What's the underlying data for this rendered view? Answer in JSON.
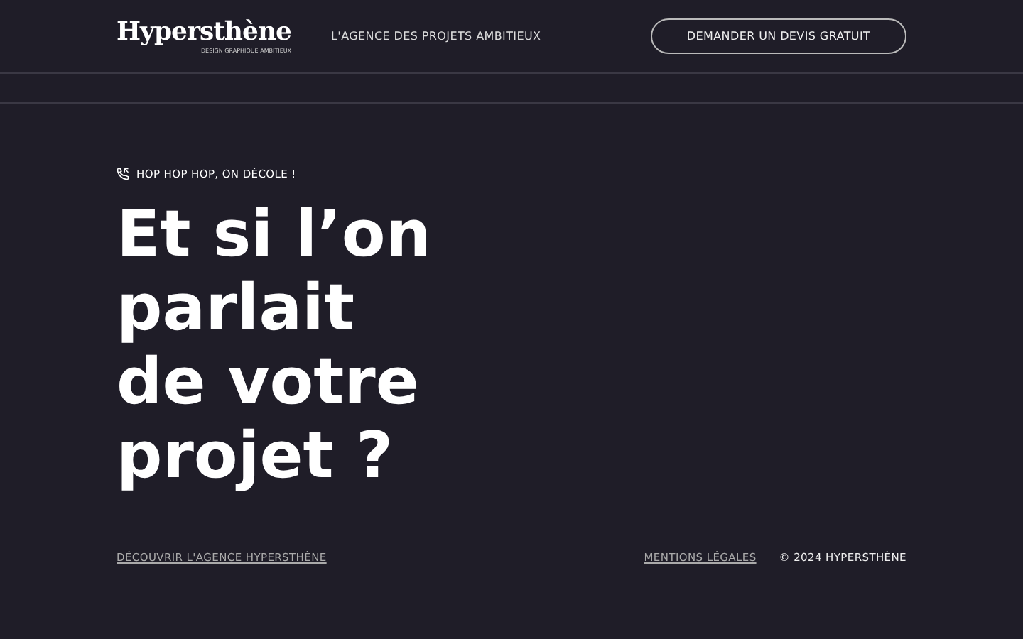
{
  "header": {
    "logo": "Hypersthène",
    "logo_tagline": "DESIGN GRAPHIQUE AMBITIEUX",
    "tagline": "L'AGENCE DES PROJETS AMBITIEUX",
    "cta": "DEMANDER UN DEVIS GRATUIT"
  },
  "hero": {
    "eyebrow": "HOP HOP HOP, ON DÉCOLE !",
    "title_lines": [
      "Et si l’on",
      "parlait",
      "de votre",
      "projet ?"
    ]
  },
  "footer": {
    "left_link": "DÉCOUVRIR L'AGENCE HYPERSTHÈNE",
    "legal_link": "MENTIONS LÉGALES",
    "copyright": "© 2024 HYPERSTHÈNE"
  }
}
